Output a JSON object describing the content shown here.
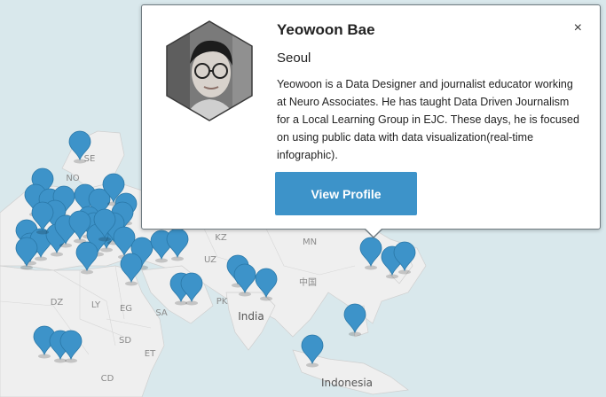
{
  "map": {
    "country_labels": [
      "SE",
      "NO",
      "KZ",
      "MN",
      "UZ",
      "中国",
      "DZ",
      "LY",
      "EG",
      "SA",
      "PK",
      "India",
      "SD",
      "ET",
      "CD",
      "Indonesia"
    ],
    "marker_count": 44,
    "marker_color": "#3d93c9"
  },
  "popup": {
    "name": "Yeowoon Bae",
    "city": "Seoul",
    "bio": "Yeowoon is a Data Designer and journalist educator working at Neuro Associates. He has taught Data Driven Journalism for a Local Learning Group in EJC. These days, he is focused on using public data with data visualization(real-time infographic).",
    "button_label": "View Profile",
    "close_glyph": "×"
  }
}
